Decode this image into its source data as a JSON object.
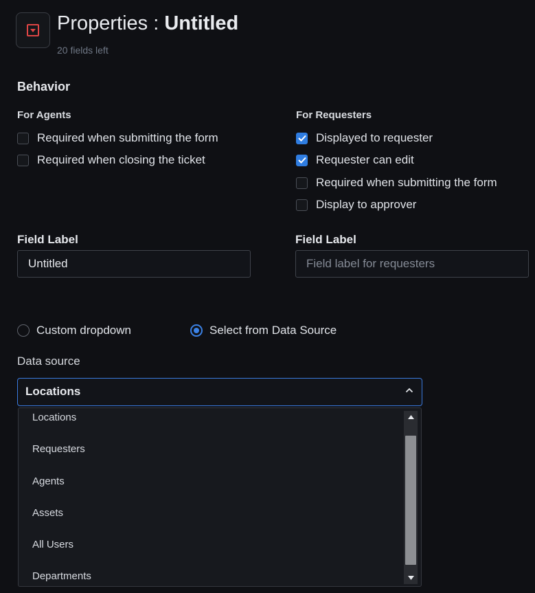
{
  "header": {
    "title_prefix": "Properties : ",
    "title_name": "Untitled",
    "subtitle": "20 fields left",
    "icon": "dropdown-field-icon"
  },
  "behavior": {
    "heading": "Behavior",
    "agents": {
      "heading": "For Agents",
      "options": [
        {
          "label": "Required when submitting the form",
          "checked": false
        },
        {
          "label": "Required when closing the ticket",
          "checked": false
        }
      ]
    },
    "requesters": {
      "heading": "For Requesters",
      "options": [
        {
          "label": "Displayed to requester",
          "checked": true
        },
        {
          "label": "Requester can edit",
          "checked": true
        },
        {
          "label": "Required when submitting the form",
          "checked": false
        },
        {
          "label": "Display to approver",
          "checked": false
        }
      ]
    }
  },
  "field_labels": {
    "agent": {
      "label": "Field Label",
      "value": "Untitled"
    },
    "requester": {
      "label": "Field Label",
      "value": "",
      "placeholder": "Field label for requesters"
    }
  },
  "choice_type": {
    "custom": {
      "label": "Custom dropdown",
      "selected": false
    },
    "data_source": {
      "label": "Select from Data Source",
      "selected": true
    }
  },
  "data_source": {
    "label": "Data source",
    "selected": "Locations",
    "options": [
      "Locations",
      "Requesters",
      "Agents",
      "Assets",
      "All Users",
      "Departments"
    ]
  },
  "colors": {
    "accent": "#3b82e6",
    "checkbox_on": "#2f7de1",
    "icon_red": "#e04545",
    "background": "#0f1014"
  }
}
